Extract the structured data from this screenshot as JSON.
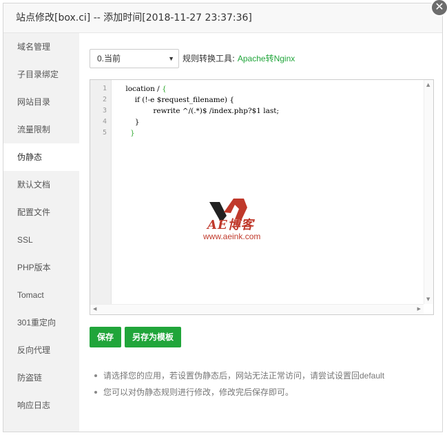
{
  "title": "站点修改[box.ci] -- 添加时间[2018-11-27 23:37:36]",
  "close_symbol": "✕",
  "sidebar": {
    "items": [
      {
        "label": "域名管理"
      },
      {
        "label": "子目录绑定"
      },
      {
        "label": "网站目录"
      },
      {
        "label": "流量限制"
      },
      {
        "label": "伪静态",
        "active": true
      },
      {
        "label": "默认文档"
      },
      {
        "label": "配置文件"
      },
      {
        "label": "SSL"
      },
      {
        "label": "PHP版本"
      },
      {
        "label": "Tomact"
      },
      {
        "label": "301重定向"
      },
      {
        "label": "反向代理"
      },
      {
        "label": "防盗链"
      },
      {
        "label": "响应日志"
      }
    ]
  },
  "rewrite_select": {
    "value": "0.当前"
  },
  "converter": {
    "label": "规则转换工具:",
    "link": "Apache转Nginx"
  },
  "editor": {
    "line_numbers": [
      "1",
      "2",
      "3",
      "4",
      "5"
    ],
    "lines": {
      "l1": "location / ",
      "l1_brace": "{",
      "l2": "        if (!-e $request_filename) {",
      "l3": "                rewrite ^/(.*)$ /index.php?$1 last;",
      "l4": "        }",
      "l5_brace": "}"
    }
  },
  "watermark": {
    "text": "AE博客",
    "url": "www.aeink.com"
  },
  "buttons": {
    "save": "保存",
    "save_template": "另存为模板"
  },
  "tips": [
    "请选择您的应用，若设置伪静态后，网站无法正常访问，请尝试设置回default",
    "您可以对伪静态规则进行修改，修改完后保存即可。"
  ],
  "colors": {
    "accent": "#20a53a",
    "watermark": "#c0392b"
  }
}
